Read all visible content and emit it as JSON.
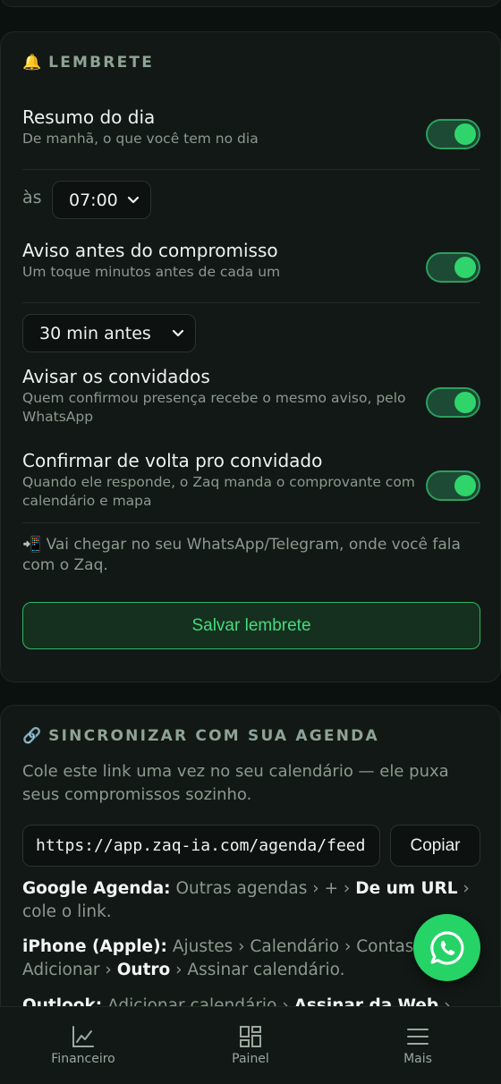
{
  "reminder": {
    "title_icon": "🔔",
    "title": "LEMBRETE",
    "daily_summary": {
      "title": "Resumo do dia",
      "description": "De manhã, o que você tem no dia",
      "enabled": true
    },
    "time_prefix": "às",
    "time_value": "07:00",
    "before_event": {
      "title": "Aviso antes do compromisso",
      "description": "Um toque minutos antes de cada um",
      "enabled": true
    },
    "minutes_value": "30 min antes",
    "notify_guests": {
      "title": "Avisar os convidados",
      "description": "Quem confirmou presença recebe o mesmo aviso, pelo WhatsApp",
      "enabled": true
    },
    "confirm_back": {
      "title": "Confirmar de volta pro convidado",
      "description": "Quando ele responde, o Zaq manda o comprovante com calendário e mapa",
      "enabled": true
    },
    "note_icon": "📲",
    "note": "Vai chegar no seu WhatsApp/Telegram, onde você fala com o Zaq.",
    "save_label": "Salvar lembrete"
  },
  "sync": {
    "title_icon": "🔗",
    "title": "SINCRONIZAR COM SUA AGENDA",
    "intro": "Cole este link uma vez no seu calendário — ele puxa seus compromissos sozinho.",
    "url": "https://app.zaq-ia.com/agenda/feed",
    "copy_label": "Copiar",
    "google": {
      "name": "Google Agenda:",
      "step1": "Outras agendas › + ›",
      "step2": "De um URL",
      "step3": "› cole o link."
    },
    "iphone": {
      "name": "iPhone (Apple):",
      "step1": "Ajustes › Calendário › Contas › Adicionar ›",
      "step2": "Outro",
      "step3": "› Assinar calendário."
    },
    "outlook": {
      "name": "Outlook:",
      "step1": "Adicionar calendário ›",
      "step2": "Assinar da Web",
      "step3": "›"
    }
  },
  "nav": {
    "items": [
      {
        "label": "Financeiro",
        "icon": "chart-line-icon"
      },
      {
        "label": "Painel",
        "icon": "grid-icon"
      },
      {
        "label": "Mais",
        "icon": "menu-icon"
      }
    ]
  },
  "fab_icon": "whatsapp-icon",
  "colors": {
    "accent": "#2fd56b",
    "background": "#0b110e",
    "card": "#121815",
    "whatsapp": "#25d366"
  }
}
